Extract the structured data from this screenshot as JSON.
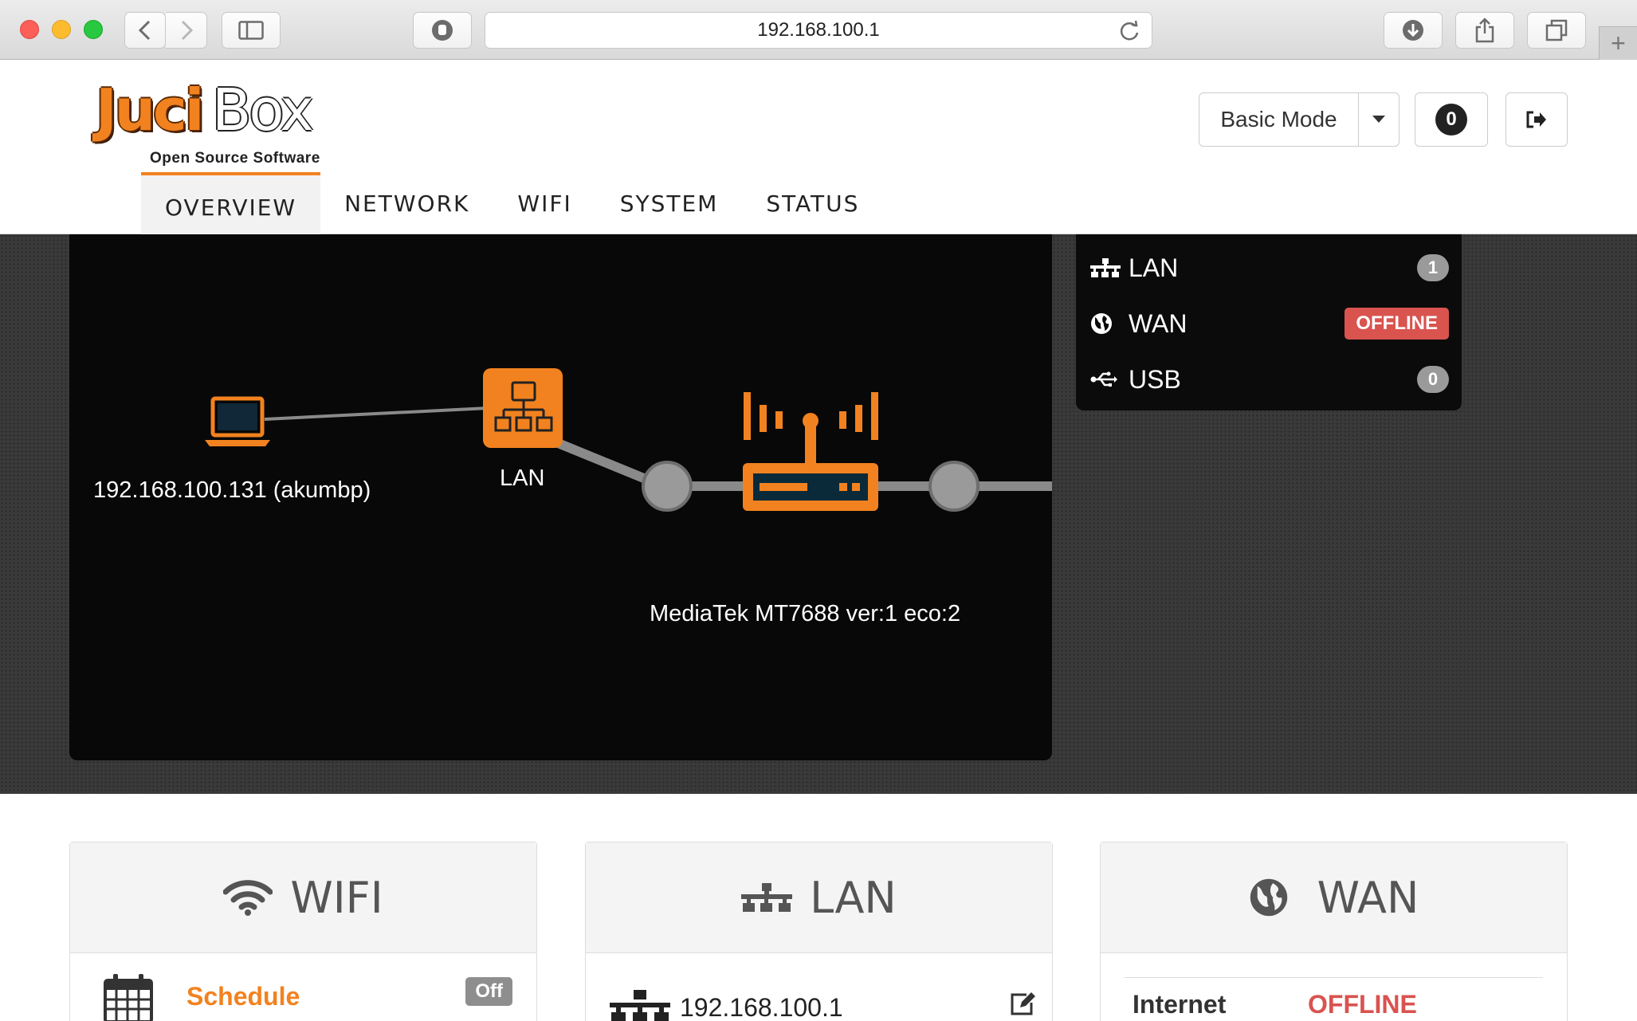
{
  "browser": {
    "url": "192.168.100.1",
    "new_tab": "+"
  },
  "header": {
    "logo_juci": "Juci",
    "logo_box": "Box",
    "logo_subtitle": "Open Source Software",
    "mode_label": "Basic Mode",
    "notification_count": "0"
  },
  "nav": {
    "items": [
      {
        "label": "OVERVIEW",
        "active": true
      },
      {
        "label": "NETWORK"
      },
      {
        "label": "WIFI"
      },
      {
        "label": "SYSTEM"
      },
      {
        "label": "STATUS"
      }
    ]
  },
  "network_map": {
    "client_label": "192.168.100.131 (akumbp)",
    "lan_node_label": "LAN",
    "router_label": "MediaTek MT7688 ver:1 eco:2"
  },
  "interfaces": {
    "lan": {
      "name": "LAN",
      "count": "1"
    },
    "wan": {
      "name": "WAN",
      "status": "OFFLINE"
    },
    "usb": {
      "name": "USB",
      "count": "0"
    }
  },
  "widgets": {
    "wifi": {
      "title": "WIFI",
      "schedule_label": "Schedule",
      "schedule_state": "Off"
    },
    "lan": {
      "title": "LAN",
      "ip": "192.168.100.1"
    },
    "wan": {
      "title": "WAN",
      "internet_label": "Internet",
      "internet_status": "OFFLINE"
    }
  },
  "colors": {
    "accent": "#f2821f",
    "danger": "#d9534f"
  }
}
